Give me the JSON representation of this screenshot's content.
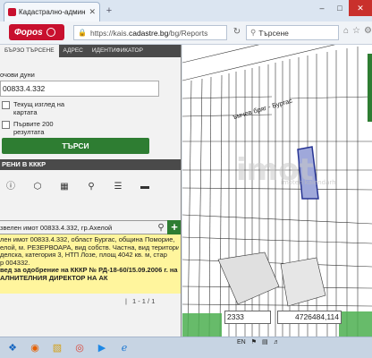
{
  "browser": {
    "tab_title": "Кадастрално-административна",
    "tab_close": "✕",
    "new_tab": "+",
    "window_controls": [
      "–",
      "□",
      "✕"
    ],
    "url_prefix": "https://kais.",
    "url_domain": "cadastre.bg",
    "url_suffix": "/bg/Reports",
    "search_placeholder": "Търсене",
    "logo_text": "Фороѕ"
  },
  "panel": {
    "tabs": [
      "Бързо търсене",
      "Адрес",
      "Идентификатор"
    ],
    "search_label": "очови дуни",
    "field_value": "00833.4.332",
    "checkbox1": [
      "Текущ изглед на",
      "картата"
    ],
    "checkbox2": [
      "Първите 200",
      "резултата"
    ],
    "search_button": "ТЪРСИ",
    "layers_header": "РЕНИ В КККР",
    "result_title": "звелен имот 00833.4.332, гр.Ахелой",
    "result_lines": [
      "лен имот 00833.4.332, област Бургас, община Поморие,",
      "елой, м. РЕЗЕРВОАРА, вид собств. Частна, вид територия",
      "делска, категория 3, НТП Лозе, площ 4042 кв. м, стар",
      "р 004332.",
      "вед за одобрение на КККР № РД-18-60/15.09.2006 г. на",
      "АЛНИТЕЛНИЯ ДИРЕКТОР НА АК"
    ],
    "pager": [
      "|",
      "1 - 1 / 1"
    ]
  },
  "map": {
    "road_label": "ъмчев бряг - Бургас",
    "watermark": "imot",
    "watermark_sub": "imoten kalendarh",
    "coord1": "2333",
    "coord2": "4726484,114"
  },
  "taskbar": {
    "tray_lang": "EN",
    "clock_time": "",
    "clock_date": ""
  },
  "colors": {
    "accent_green": "#2e7d32",
    "result_highlight": "#fff59d",
    "selected_parcel": "#3f51b5",
    "brand_red": "#c8102e"
  }
}
